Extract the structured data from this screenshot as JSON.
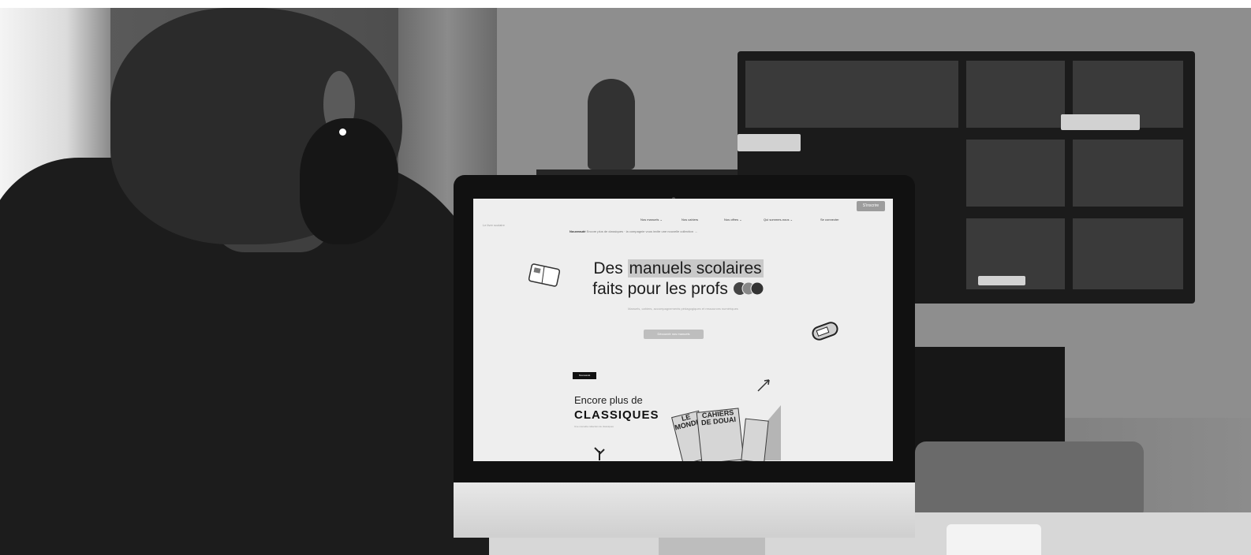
{
  "photo": {
    "description_free": true
  },
  "screen": {
    "nav": {
      "logo": "Le livre scolaire",
      "links": [
        "Nos manuels ⌄",
        "Nos cahiers",
        "Nos offres ⌄",
        "Qui sommes-nous ⌄",
        "Se connecter"
      ],
      "cta": "S'inscrire"
    },
    "announcement": {
      "badge": "Nouveauté",
      "text": "Encore plus de classiques · la compagnie vous invite une nouvelle collection →"
    },
    "hero": {
      "title_line1_pre": "Des ",
      "title_line1_hl": "manuels scolaires",
      "title_line2": "faits pour les profs",
      "subtitle": "Manuels, cahiers, accompagnements pédagogiques et ressources numériques",
      "cta": "Découvrir nos manuels"
    },
    "promo": {
      "badge": "Nouveauté",
      "line1": "Encore plus de",
      "line2": "CLASSIQUES",
      "line3": "Une nouvelle collection de classiques",
      "book1": "CAHIERS DE DOUAI",
      "book2": "LE MONDE"
    }
  },
  "colors": {
    "screen_bg": "#eeeeee",
    "highlight": "#c9c9c9",
    "cta": "#9c9c9c"
  }
}
